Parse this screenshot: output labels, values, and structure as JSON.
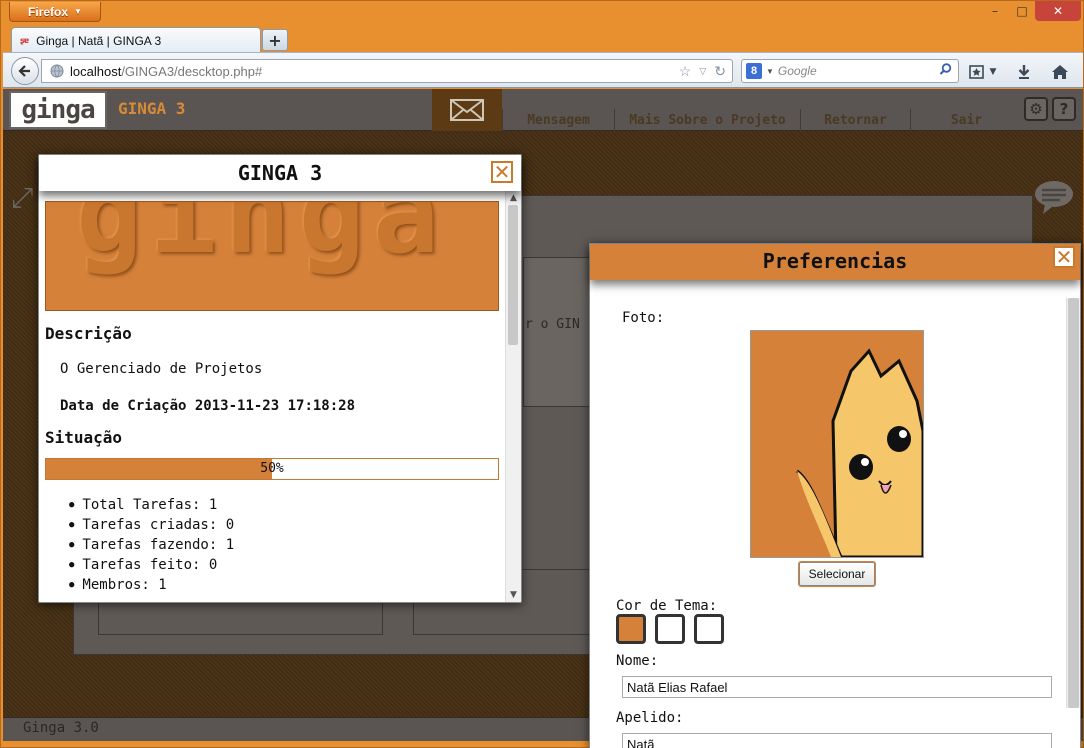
{
  "browser": {
    "menu_label": "Firefox",
    "menu_arrow": "▼",
    "tab_title": "Ginga | Natã | GINGA 3",
    "tab_favicon": "ʂɐ",
    "new_tab_label": "+",
    "url_host": "localhost",
    "url_path": "/GINGA3/descktop.php#",
    "search_placeholder": "Google",
    "search_engine_badge": "8",
    "window_controls": {
      "minimize": "–",
      "maximize": "□",
      "close": "✕"
    }
  },
  "app": {
    "logo_text": "ginga",
    "title": "GINGA 3",
    "nav": [
      "Mensagem",
      "Mais Sobre o Projeto",
      "Retornar",
      "Sair"
    ],
    "footer": "Ginga 3.0",
    "background_text": "r o GIN"
  },
  "project_window": {
    "title": "GINGA 3",
    "close_label": "✕",
    "logo_text": "ginga",
    "description_heading": "Descrição",
    "description": "O Gerenciado de Projetos",
    "created_label": "Data de Criação",
    "created_value": "2013-11-23 17:18:28",
    "status_heading": "Situação",
    "progress_percent": 50,
    "progress_label": "50%",
    "stats": [
      "Total Tarefas: 1",
      "Tarefas criadas: 0",
      "Tarefas fazendo: 1",
      "Tarefas feito: 0",
      "Membros: 1"
    ]
  },
  "preferences_window": {
    "title": "Preferencias",
    "close_label": "✕",
    "photo_label": "Foto:",
    "select_button": "Selecionar",
    "theme_label": "Cor de Tema:",
    "theme_colors": [
      "#d5813a",
      "#ffffff",
      "#ffffff"
    ],
    "selected_theme": 0,
    "name_label": "Nome:",
    "name_value": "Natã Elias Rafael",
    "nickname_label": "Apelido:",
    "nickname_value": "Natã"
  },
  "colors": {
    "accent": "#d5813a",
    "header_bg": "#5a5552",
    "frame": "#e8902f"
  }
}
